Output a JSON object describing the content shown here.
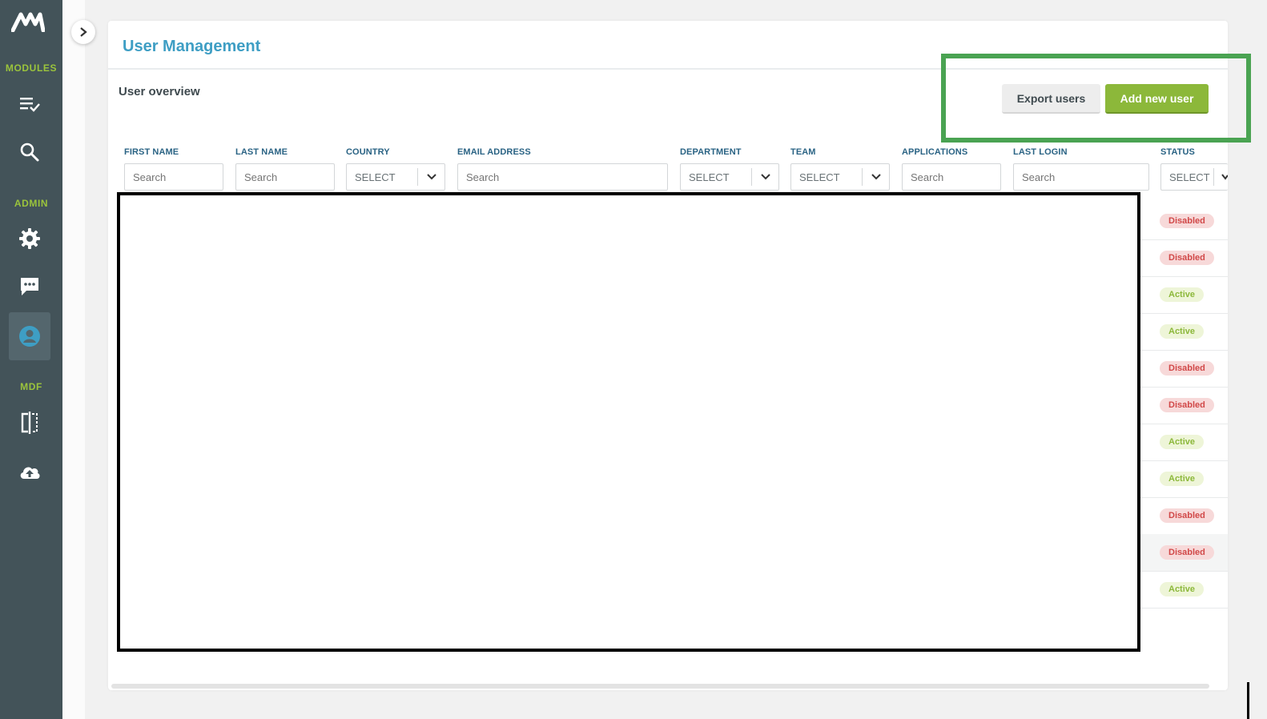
{
  "sidebar": {
    "sections": {
      "modules": "MODULES",
      "admin": "ADMIN",
      "mdf": "MDF"
    },
    "icons": [
      "logo-icon",
      "task-list-icon",
      "search-icon",
      "gear-icon",
      "chat-icon",
      "user-account-icon",
      "compare-icon",
      "cloud-upload-icon"
    ],
    "active_item": "user-account-icon"
  },
  "page": {
    "title": "User Management",
    "subtitle": "User overview"
  },
  "actions": {
    "export_label": "Export users",
    "add_label": "Add new user"
  },
  "filters": {
    "first_name": {
      "label": "FIRST NAME",
      "placeholder": "Search"
    },
    "last_name": {
      "label": "LAST NAME",
      "placeholder": "Search"
    },
    "country": {
      "label": "COUNTRY",
      "value": "SELECT"
    },
    "email": {
      "label": "EMAIL ADDRESS",
      "placeholder": "Search"
    },
    "department": {
      "label": "DEPARTMENT",
      "value": "SELECT"
    },
    "team": {
      "label": "TEAM",
      "value": "SELECT"
    },
    "applications": {
      "label": "APPLICATIONS",
      "placeholder": "Search"
    },
    "last_login": {
      "label": "LAST LOGIN",
      "placeholder": "Search"
    },
    "status": {
      "label": "STATUS",
      "value": "SELECT"
    }
  },
  "rows": [
    {
      "status": "Disabled"
    },
    {
      "status": "Disabled"
    },
    {
      "status": "Active"
    },
    {
      "status": "Active"
    },
    {
      "status": "Disabled"
    },
    {
      "status": "Disabled"
    },
    {
      "status": "Active"
    },
    {
      "status": "Active"
    },
    {
      "status": "Disabled"
    },
    {
      "status": "Disabled"
    },
    {
      "status": "Active"
    }
  ],
  "colors": {
    "sidebar": "#435359",
    "accent_green": "#8cb83a",
    "title_blue": "#3e9ec4",
    "label_blue": "#2a6384",
    "disabled_red": "#d14848",
    "highlight_box": "#4aa352",
    "redaction_border": "#000000"
  }
}
